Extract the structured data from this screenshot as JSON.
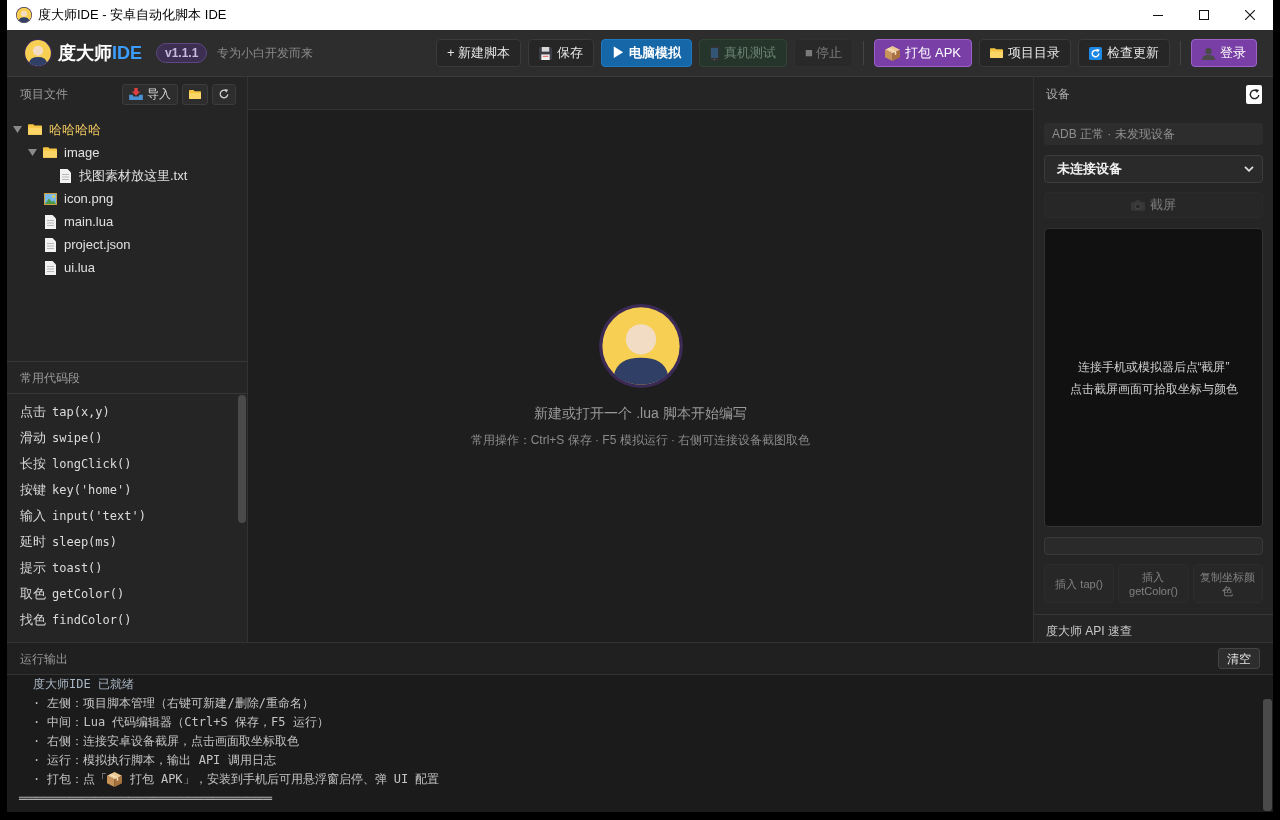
{
  "window": {
    "title": "度大师IDE - 安卓自动化脚本 IDE"
  },
  "header": {
    "brand": "度大师",
    "brand_accent": "IDE",
    "version": "v1.1.1",
    "tagline": "专为小白开发而来"
  },
  "toolbar": {
    "groups": [
      [
        {
          "label": "+ 新建脚本",
          "kind": "new",
          "disabled": false
        },
        {
          "label": "保存",
          "kind": "save",
          "disabled": false
        },
        {
          "label": "▶ 电脑模拟",
          "kind": "simulate",
          "disabled": false
        },
        {
          "label": "真机测试",
          "kind": "device-test",
          "disabled": true
        },
        {
          "label": "■ 停止",
          "kind": "stop",
          "disabled": true
        }
      ],
      [
        {
          "label": "打包 APK",
          "kind": "package",
          "disabled": false
        },
        {
          "label": "项目目录",
          "kind": "folder",
          "disabled": false
        },
        {
          "label": "检查更新",
          "kind": "update",
          "disabled": false
        }
      ],
      [
        {
          "label": "登录",
          "kind": "login",
          "disabled": false
        }
      ]
    ]
  },
  "files": {
    "title": "项目文件",
    "import_label": "导入",
    "tree": [
      {
        "name": "哈哈哈哈",
        "kind": "folder",
        "expanded": true,
        "children": [
          {
            "name": "image",
            "kind": "folder",
            "expanded": true,
            "children": [
              {
                "name": "找图素材放这里.txt",
                "kind": "file"
              }
            ]
          },
          {
            "name": "icon.png",
            "kind": "image"
          },
          {
            "name": "main.lua",
            "kind": "file"
          },
          {
            "name": "project.json",
            "kind": "file"
          },
          {
            "name": "ui.lua",
            "kind": "file"
          }
        ]
      }
    ]
  },
  "snippets": {
    "title": "常用代码段",
    "items": [
      {
        "label": "点击",
        "code": "tap(x,y)"
      },
      {
        "label": "滑动",
        "code": "swipe()"
      },
      {
        "label": "长按",
        "code": "longClick()"
      },
      {
        "label": "按键",
        "code": "key('home')"
      },
      {
        "label": "输入",
        "code": "input('text')"
      },
      {
        "label": "延时",
        "code": "sleep(ms)"
      },
      {
        "label": "提示",
        "code": "toast()"
      },
      {
        "label": "取色",
        "code": "getColor()"
      },
      {
        "label": "找色",
        "code": "findColor()"
      }
    ]
  },
  "editor": {
    "title": "新建或打开一个 .lua 脚本开始编写",
    "hint": "常用操作：Ctrl+S 保存 · F5 模拟运行 · 右侧可连接设备截图取色"
  },
  "device": {
    "title": "设备",
    "status": "ADB 正常 · 未发现设备",
    "select_value": "未连接设备",
    "screenshot_button": {
      "label": "截屏",
      "disabled": true
    },
    "preview_lines": [
      "连接手机或模拟器后点“截屏”",
      "点击截屏画面可拾取坐标与颜色"
    ],
    "actions": [
      {
        "label": "插入 tap()",
        "disabled": true
      },
      {
        "label": "插入 getColor()",
        "disabled": true
      },
      {
        "label": "复制坐标颜色",
        "disabled": true
      }
    ],
    "api_title": "度大师 API 速查"
  },
  "output": {
    "title": "运行输出",
    "clear_label": "清空",
    "lines": [
      {
        "kind": "info",
        "text": "度大师IDE 已就绪"
      },
      {
        "kind": "item",
        "text": "· 左侧：项目脚本管理（右键可新建/删除/重命名）"
      },
      {
        "kind": "item",
        "text": "· 中间：Lua 代码编辑器（Ctrl+S 保存，F5 运行）"
      },
      {
        "kind": "item",
        "text": "· 右侧：连接安卓设备截屏，点击画面取坐标取色"
      },
      {
        "kind": "item",
        "text": "· 运行：模拟执行脚本，输出 API 调用日志"
      },
      {
        "kind": "item-icon",
        "before": "· 打包：点「",
        "after": " 打包 APK」，安装到手机后可用悬浮窗启停、弹 UI 配置"
      },
      {
        "kind": "rule",
        "text": "══════════════════════════════"
      }
    ]
  }
}
